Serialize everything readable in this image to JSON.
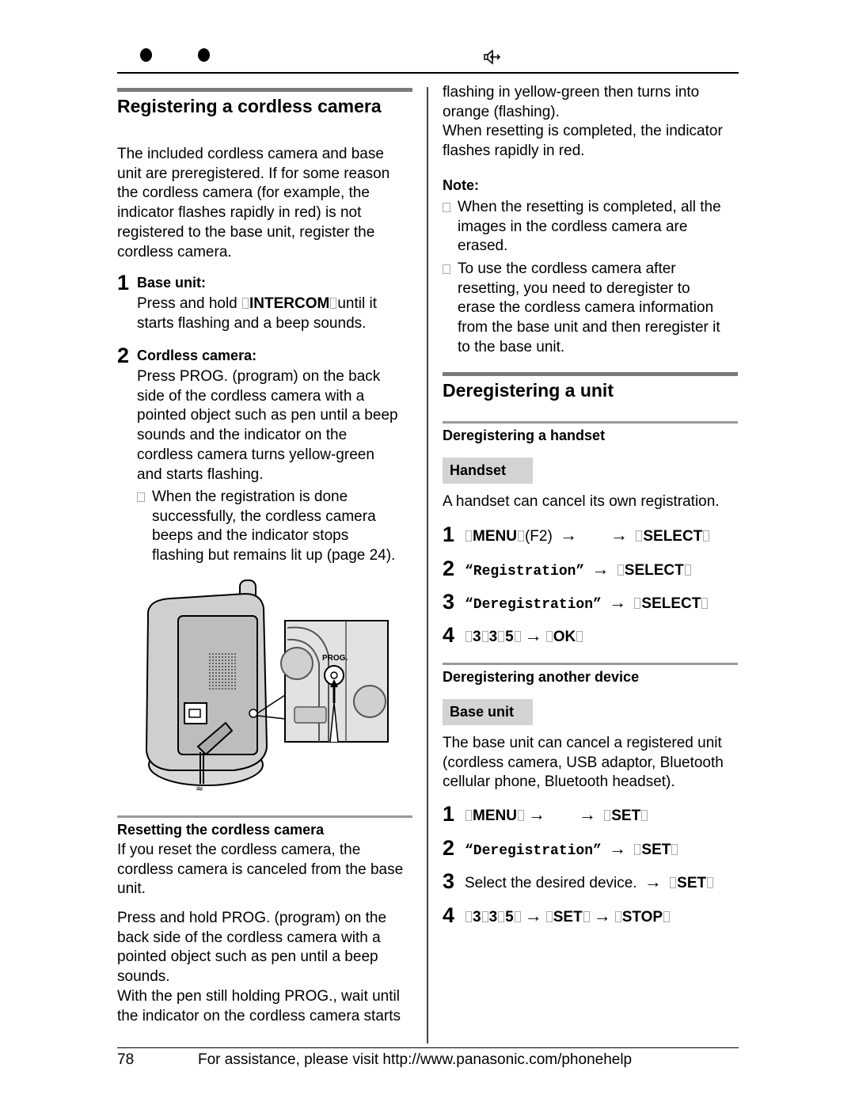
{
  "header": {
    "icons": [
      "bullet-dot-icon",
      "bullet-dot-icon",
      "intercom-speaker-icon"
    ]
  },
  "left": {
    "title": "Registering a cordless camera",
    "intro": "The included cordless camera and base\nunit are preregistered. If for some reason\nthe cordless camera (for example, the\nindicator flashes rapidly in red) is not\nregistered to the base unit, register the\ncordless camera.",
    "steps": [
      {
        "num": "1",
        "label": "Base unit:",
        "body_pre": "Press and hold ",
        "key": "INTERCOM",
        "body_post": "until it",
        "body_line2": "starts flashing and a beep sounds."
      },
      {
        "num": "2",
        "label": "Cordless camera:",
        "body": "Press PROG. (program) on the back\nside of the cordless camera with a\npointed object such as pen until a beep\nsounds and the indicator on the\ncordless camera turns yellow-green\nand starts flashing.",
        "bullet": "When the registration is done\nsuccessfully, the cordless camera\nbeeps and the indicator stops\nflashing but remains lit up (page 24)."
      }
    ],
    "figure": {
      "prog_label": "PROG."
    },
    "reset": {
      "title": "Resetting the cordless camera",
      "para1": "If you reset the cordless camera, the\ncordless camera is canceled from the base\nunit.",
      "para2": "Press and hold PROG. (program) on the\nback side of the cordless camera with a\npointed object such as pen until a beep\nsounds.\nWith the pen still holding PROG., wait until\nthe indicator on the cordless camera starts"
    }
  },
  "right": {
    "continued": "flashing in yellow-green then turns into\norange (flashing).\nWhen resetting is completed, the indicator\nflashes rapidly in red.",
    "note_label": "Note:",
    "notes": [
      "When the resetting is completed, all the\nimages in the cordless camera are\nerased.",
      "To use the cordless camera after\nresetting, you need to deregister to\nerase the cordless camera information\nfrom the base unit and then reregister it\nto the base unit."
    ],
    "dereg_title": "Deregistering a unit",
    "handset_section": {
      "title": "Deregistering a handset",
      "badge": "Handset",
      "desc": "A handset can cancel its own registration.",
      "steps": [
        {
          "num": "1",
          "parts": {
            "k1": "MENU",
            "t1": "(F2)",
            "k2": "SELECT"
          }
        },
        {
          "num": "2",
          "parts": {
            "m": "“Registration”",
            "k": "SELECT"
          }
        },
        {
          "num": "3",
          "parts": {
            "m": "“Deregistration”",
            "k": "SELECT"
          }
        },
        {
          "num": "4",
          "parts": {
            "d1": "3",
            "d2": "3",
            "d3": "5",
            "k": "OK"
          }
        }
      ]
    },
    "other_section": {
      "title": "Deregistering another device",
      "badge": "Base unit",
      "desc": "The base unit can cancel a registered unit\n(cordless camera, USB adaptor, Bluetooth\ncellular phone, Bluetooth headset).",
      "steps": [
        {
          "num": "1",
          "parts": {
            "k1": "MENU",
            "k2": "SET"
          }
        },
        {
          "num": "2",
          "parts": {
            "m": "“Deregistration”",
            "k": "SET"
          }
        },
        {
          "num": "3",
          "parts": {
            "t": "Select the desired device.",
            "k": "SET"
          }
        },
        {
          "num": "4",
          "parts": {
            "d1": "3",
            "d2": "3",
            "d3": "5",
            "k1": "SET",
            "k2": "STOP"
          }
        }
      ]
    }
  },
  "footer": {
    "page_number": "78",
    "assist_text": "For assistance, please visit http://www.panasonic.com/phonehelp"
  },
  "symbols": {
    "arrow": "→"
  }
}
